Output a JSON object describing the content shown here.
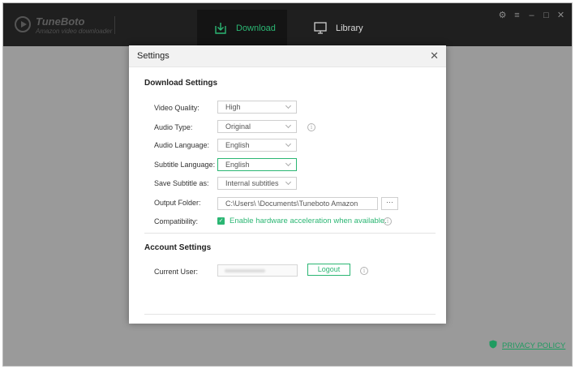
{
  "app": {
    "name": "TuneBoto",
    "subtitle": "Amazon video downloader"
  },
  "tabs": [
    {
      "label": "Download",
      "icon": "download-icon",
      "active": true
    },
    {
      "label": "Library",
      "icon": "monitor-icon",
      "active": false
    }
  ],
  "window_controls": [
    "gear-icon",
    "menu-icon",
    "minimize-icon",
    "maximize-icon",
    "close-icon"
  ],
  "dialog": {
    "title": "Settings",
    "download_settings": {
      "heading": "Download Settings",
      "video_quality": {
        "label": "Video Quality:",
        "value": "High"
      },
      "audio_type": {
        "label": "Audio Type:",
        "value": "Original"
      },
      "audio_language": {
        "label": "Audio Language:",
        "value": "English"
      },
      "subtitle_language": {
        "label": "Subtitle Language:",
        "value": "English"
      },
      "save_subtitle": {
        "label": "Save Subtitle as:",
        "value": "Internal subtitles"
      },
      "output_folder": {
        "label": "Output Folder:",
        "value": "C:\\Users\\        \\Documents\\Tuneboto Amazon",
        "browse": "···"
      },
      "compatibility": {
        "label": "Compatibility:",
        "option": "Enable hardware acceleration when available.",
        "checked": true
      }
    },
    "account_settings": {
      "heading": "Account Settings",
      "current_user": {
        "label": "Current User:"
      },
      "logout": "Logout"
    }
  },
  "footer": {
    "privacy": "PRIVACY POLICY"
  },
  "colors": {
    "accent": "#2bb673",
    "titlebar": "#1f1f1f",
    "backdrop": "#9a9a9a"
  }
}
